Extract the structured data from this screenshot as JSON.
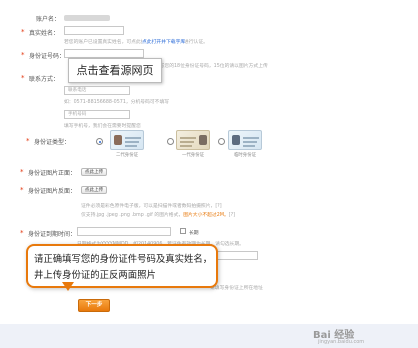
{
  "account": {
    "label": "账户名：",
    "value_masked": "●●●●●●●●"
  },
  "realname": {
    "label": "真实姓名：",
    "hint": "若您的账户已设置真实姓名，可点此打开修改链接下载并进行认证。",
    "hint_link": "点此打开并下载字库"
  },
  "idnumber": {
    "label": "身份证号码：",
    "hint": "请填写您的18位身份证号码，15位的请以图片方式上传"
  },
  "contact": {
    "label": "联系方式：",
    "fixed_placeholder": "联系电话",
    "fixed_hint": "如：0571-88156688-0571，分机号码可不填写",
    "mobile_placeholder": "手机号码",
    "mobile_hint": "填写手机号，我们会在需要时提醒您"
  },
  "idtype": {
    "label": "身份证类型：",
    "options": [
      {
        "caption": "二代身份证",
        "selected": true
      },
      {
        "caption": "一代身份证",
        "selected": false
      },
      {
        "caption": "临时身份证",
        "selected": false
      }
    ]
  },
  "front": {
    "label": "身份证图片正面：",
    "button": "点此上传"
  },
  "back": {
    "label": "身份证图片反面：",
    "button": "点此上传",
    "hint1": "证件必须是彩色原件电子版，可以是扫描件或者数码拍摄照片，[?]",
    "hint2_prefix": "仅支持.jpg .jpeg .png .bmp .gif 的图片格式，",
    "hint2_em": "图片大小不超过2M。",
    "hint2_suffix": "[?]"
  },
  "expiry": {
    "label": "身份证到期时间：",
    "longterm": "长期",
    "hint": "日期格式为YYYYMMDD，如20140906，若证件有效期为长期，请勾选长期。"
  },
  "address": {
    "hint": "请填写身份证上所在地址"
  },
  "next_button": "下一步",
  "overlay_top": {
    "text": "点击查看源网页"
  },
  "overlay_callout": {
    "line1": "请正确填写您的身份证件号码及真实姓名，",
    "line2": "井上传身份证的正反两面照片"
  },
  "watermark": {
    "text": "Bai 经验",
    "sub": "jingyan.baidu.com"
  },
  "colors": {
    "accent": "#e8790c",
    "required": "#e2350d",
    "link": "#2a6bd8"
  }
}
